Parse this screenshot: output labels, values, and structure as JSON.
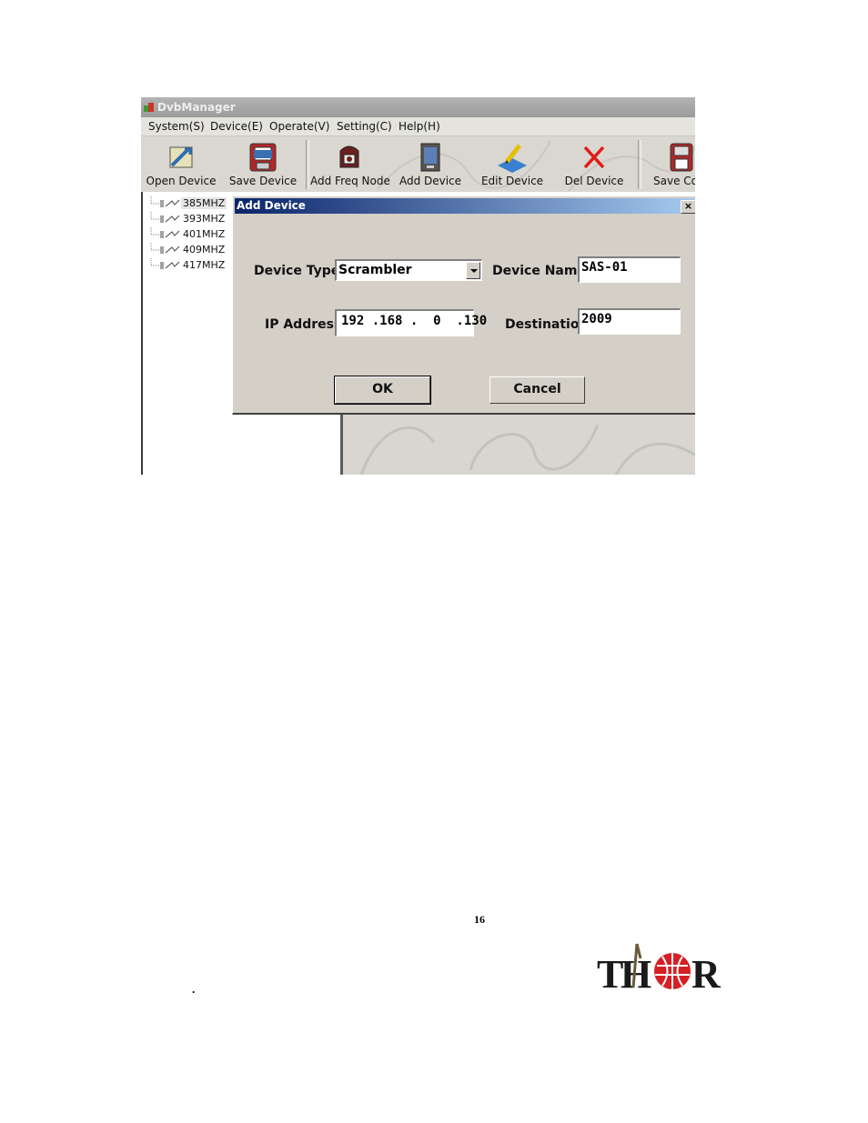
{
  "window": {
    "title": "DvbManager"
  },
  "menu": {
    "items": [
      "System(S)",
      "Device(E)",
      "Operate(V)",
      "Setting(C)",
      "Help(H)"
    ]
  },
  "toolbar": {
    "buttons": [
      {
        "label": "Open Device",
        "icon": "open-device-icon"
      },
      {
        "label": "Save Device",
        "icon": "save-device-icon"
      },
      {
        "label": "Add Freq Node",
        "icon": "add-freq-node-icon"
      },
      {
        "label": "Add Device",
        "icon": "add-device-icon"
      },
      {
        "label": "Edit Device",
        "icon": "edit-device-icon"
      },
      {
        "label": "Del Device",
        "icon": "delete-icon"
      },
      {
        "label": "Save Cor",
        "icon": "save-config-icon"
      }
    ]
  },
  "tree": {
    "items": [
      "385MHZ",
      "393MHZ",
      "401MHZ",
      "409MHZ",
      "417MHZ"
    ],
    "selected": "385MHZ"
  },
  "dialog": {
    "title": "Add Device",
    "close_label": "×",
    "device_type_label": "Device Type",
    "device_type_value": "Scrambler",
    "device_name_label": "Device Name",
    "device_name_value": "SAS-01",
    "ip_label": "IP Address",
    "ip_value": "192 .168 .  0  .130",
    "destination_label": "Destination",
    "destination_value": "2009",
    "ok_label": "OK",
    "cancel_label": "Cancel"
  },
  "page": {
    "number": "16",
    "dot": "."
  },
  "logo": {
    "text": "THOR"
  },
  "colors": {
    "dialog_title": "#0a246a",
    "logo_red": "#d42025",
    "logo_dark": "#1a1a1a"
  }
}
